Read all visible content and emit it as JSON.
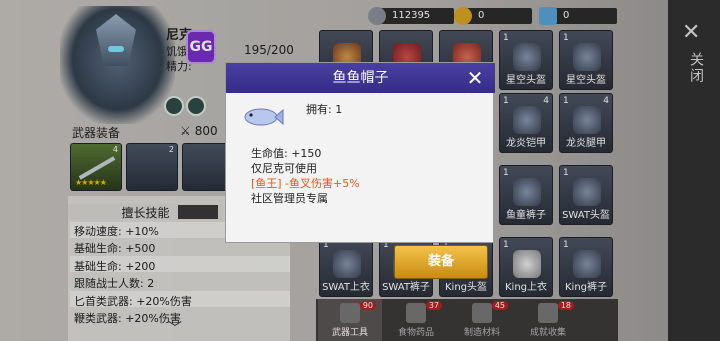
{
  "character": {
    "name": "尼克",
    "stat1_label": "饥饿",
    "stat2_label": "精力:",
    "hp": "195/200",
    "gg_label": "GG",
    "weapon_section": "武器装备",
    "power": "800"
  },
  "resources": [
    {
      "icon": "silver-coins-icon",
      "value": "112395",
      "color": "#8a8f99"
    },
    {
      "icon": "gold-coin-icon",
      "value": "0",
      "color": "#d9a521"
    },
    {
      "icon": "ticket-icon",
      "value": "0",
      "color": "#5aa3d8"
    }
  ],
  "equipment_slots": [
    {
      "num": "4",
      "stars": "★★★★★"
    },
    {
      "num": "2",
      "stars": ""
    },
    {
      "num": "3",
      "stars": ""
    }
  ],
  "skills_panel": {
    "title": "擅长技能",
    "lines": [
      "移动速度: +10%",
      "基础生命: +500",
      "基础生命: +200",
      "跟随战士人数: 2",
      "匕首类武器: +20%伤害",
      "鞭类武器: +20%伤害"
    ]
  },
  "grid": [
    {
      "num": "",
      "num2": "",
      "label": ""
    },
    {
      "num": "",
      "num2": "",
      "label": ""
    },
    {
      "num": "",
      "num2": "",
      "label": ""
    },
    {
      "num": "1",
      "num2": "",
      "label": "星空头盔"
    },
    {
      "num": "1",
      "num2": "",
      "label": "星空头盔"
    },
    {
      "num": "1",
      "num2": "4",
      "label": "龙炎铠甲"
    },
    {
      "num": "1",
      "num2": "4",
      "label": "龙炎腿甲"
    },
    {
      "num": "1",
      "num2": "",
      "label": "鱼童裤子"
    },
    {
      "num": "1",
      "num2": "",
      "label": "SWAT头盔"
    },
    {
      "num": "1",
      "num2": "",
      "label": "SWAT上衣"
    },
    {
      "num": "1",
      "num2": "",
      "label": "SWAT裤子"
    },
    {
      "num": "1",
      "num2": "",
      "label": "King头盔"
    },
    {
      "num": "1",
      "num2": "",
      "label": "King上衣"
    },
    {
      "num": "1",
      "num2": "",
      "label": "King裤子"
    }
  ],
  "tabs": [
    {
      "label": "武器工具",
      "badge": "90"
    },
    {
      "label": "食物药品",
      "badge": "37"
    },
    {
      "label": "制造材料",
      "badge": "45"
    },
    {
      "label": "成就收集",
      "badge": "18"
    }
  ],
  "close_panel": {
    "label": "关闭"
  },
  "modal": {
    "title": "鱼鱼帽子",
    "owned": "拥有: 1",
    "lines": [
      {
        "text": "生命值: +150",
        "color": "#222222"
      },
      {
        "text": "仅尼克可使用",
        "color": "#222222"
      },
      {
        "text": "[鱼王] -鱼叉伤害+5%",
        "color": "#e2561f"
      },
      {
        "text": "社区管理员专属",
        "color": "#222222"
      }
    ],
    "equip_label": "装备"
  }
}
